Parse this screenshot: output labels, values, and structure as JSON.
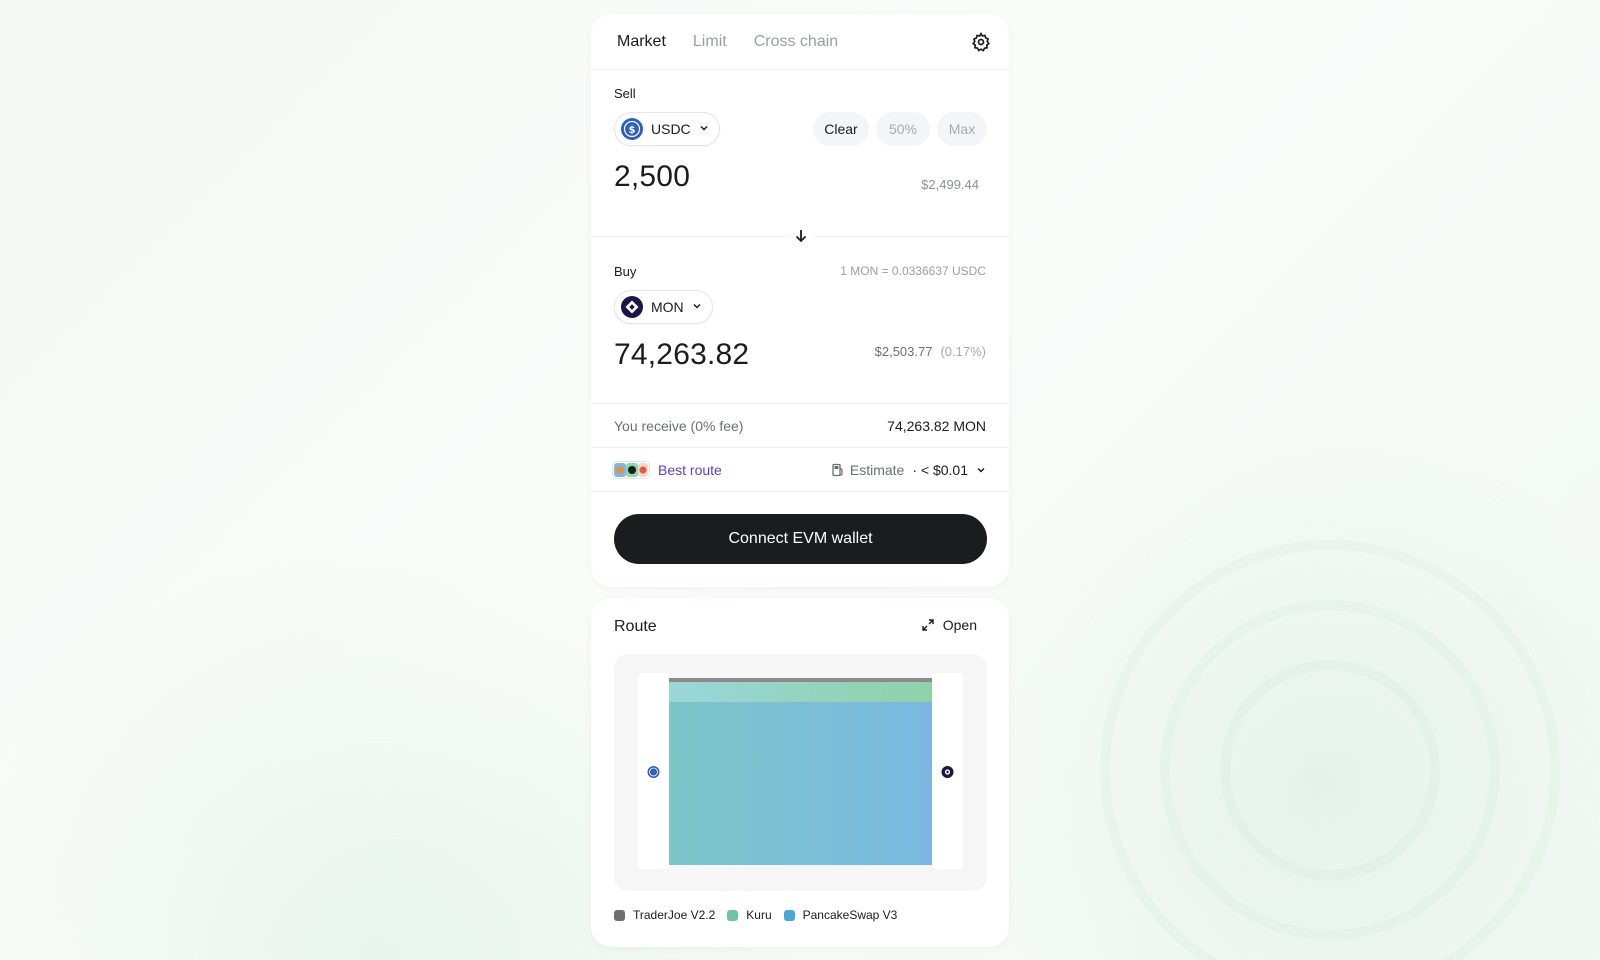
{
  "tabs": [
    {
      "label": "Market",
      "active": true
    },
    {
      "label": "Limit",
      "active": false
    },
    {
      "label": "Cross chain",
      "active": false
    }
  ],
  "settings_icon": "gear-icon",
  "sell": {
    "label": "Sell",
    "token": "USDC",
    "token_icon": "usdc-icon",
    "chips": [
      "Clear",
      "50%",
      "Max"
    ],
    "amount": "2,500",
    "fiat": "$2,499.44"
  },
  "swap_icon": "arrow-down-icon",
  "buy": {
    "label": "Buy",
    "rate": "1 MON = 0.0336637 USDC",
    "token": "MON",
    "token_icon": "mon-icon",
    "amount": "74,263.82",
    "fiat": "$2,503.77",
    "price_impact": "(0.17%)"
  },
  "receive": {
    "label": "You receive (0% fee)",
    "value": "74,263.82 MON"
  },
  "route_row": {
    "label": "Best route",
    "gas_label": "Estimate",
    "gas_value": "· < $0.01"
  },
  "connect_button": "Connect EVM wallet",
  "route": {
    "title": "Route",
    "open_label": "Open",
    "legend": [
      {
        "name": "TraderJoe V2.2",
        "color": "#6e6e6e"
      },
      {
        "name": "Kuru",
        "color": "#6cc4a4"
      },
      {
        "name": "PancakeSwap V3",
        "color": "#4aa8d8"
      }
    ]
  },
  "colors": {
    "accent_link": "#5b3fd1",
    "button_bg": "#1b1c1e"
  }
}
